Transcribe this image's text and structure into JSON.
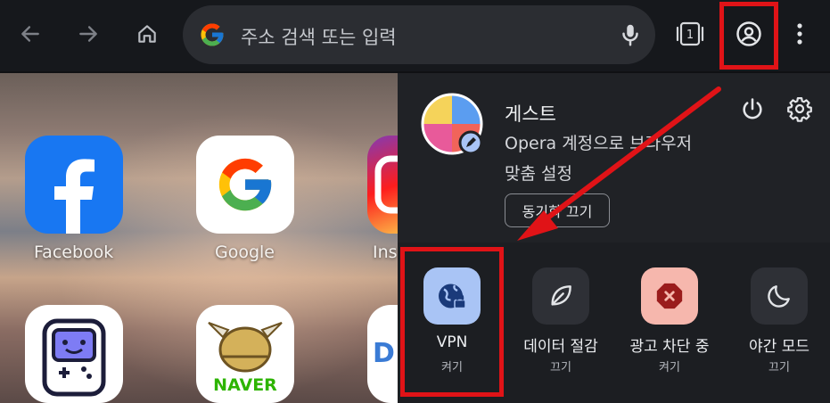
{
  "toolbar": {
    "address_placeholder": "주소 검색 또는 입력",
    "tab_count": "1"
  },
  "speed_dial": [
    {
      "label": "Facebook"
    },
    {
      "label": "Google"
    },
    {
      "label": "Ins"
    },
    {
      "label": "NAVER"
    }
  ],
  "profile_panel": {
    "name": "게스트",
    "description": "Opera 계정으로 브라우저",
    "customize": "맞춤 설정",
    "sync_button": "동기화 끄기",
    "tiles": [
      {
        "label": "VPN",
        "status": "켜기"
      },
      {
        "label": "데이터 절감",
        "status": "끄기"
      },
      {
        "label": "광고 차단 중",
        "status": "켜기"
      },
      {
        "label": "야간 모드",
        "status": "끄기"
      }
    ]
  },
  "colors": {
    "highlight": "#e01317",
    "vpn_tile": "#a9c4f5",
    "adblock_tile": "#f6b7ad"
  }
}
